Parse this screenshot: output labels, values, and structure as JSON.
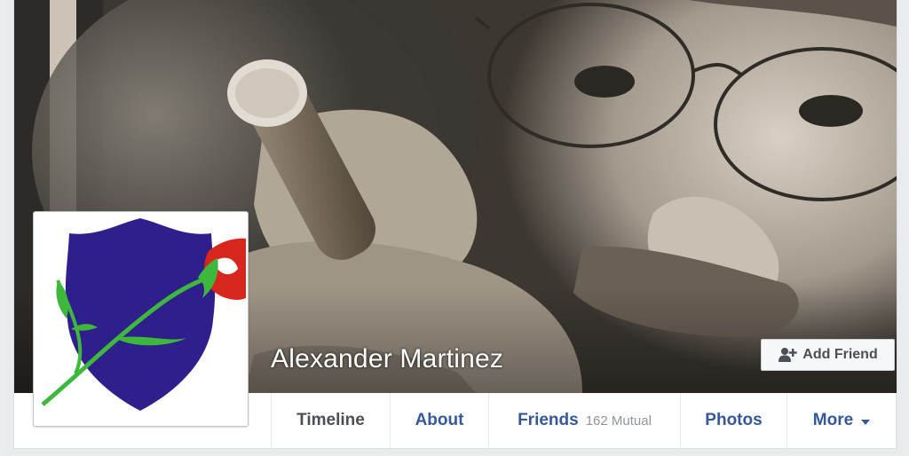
{
  "profile": {
    "name": "Alexander Martinez"
  },
  "actions": {
    "add_friend_label": "Add Friend",
    "add_friend_icon": "add-friend-icon"
  },
  "nav": {
    "tabs": [
      {
        "label": "Timeline",
        "active": true
      },
      {
        "label": "About"
      },
      {
        "label": "Friends",
        "count": "162 Mutual"
      },
      {
        "label": "Photos"
      },
      {
        "label": "More",
        "icon": "caret-down-icon"
      }
    ]
  },
  "colors": {
    "link": "#365899",
    "active_tab": "#4b4f56",
    "muted": "#90949c",
    "shield": "#2e1f8c",
    "stem": "#3db83d",
    "rose": "#d9261c"
  }
}
